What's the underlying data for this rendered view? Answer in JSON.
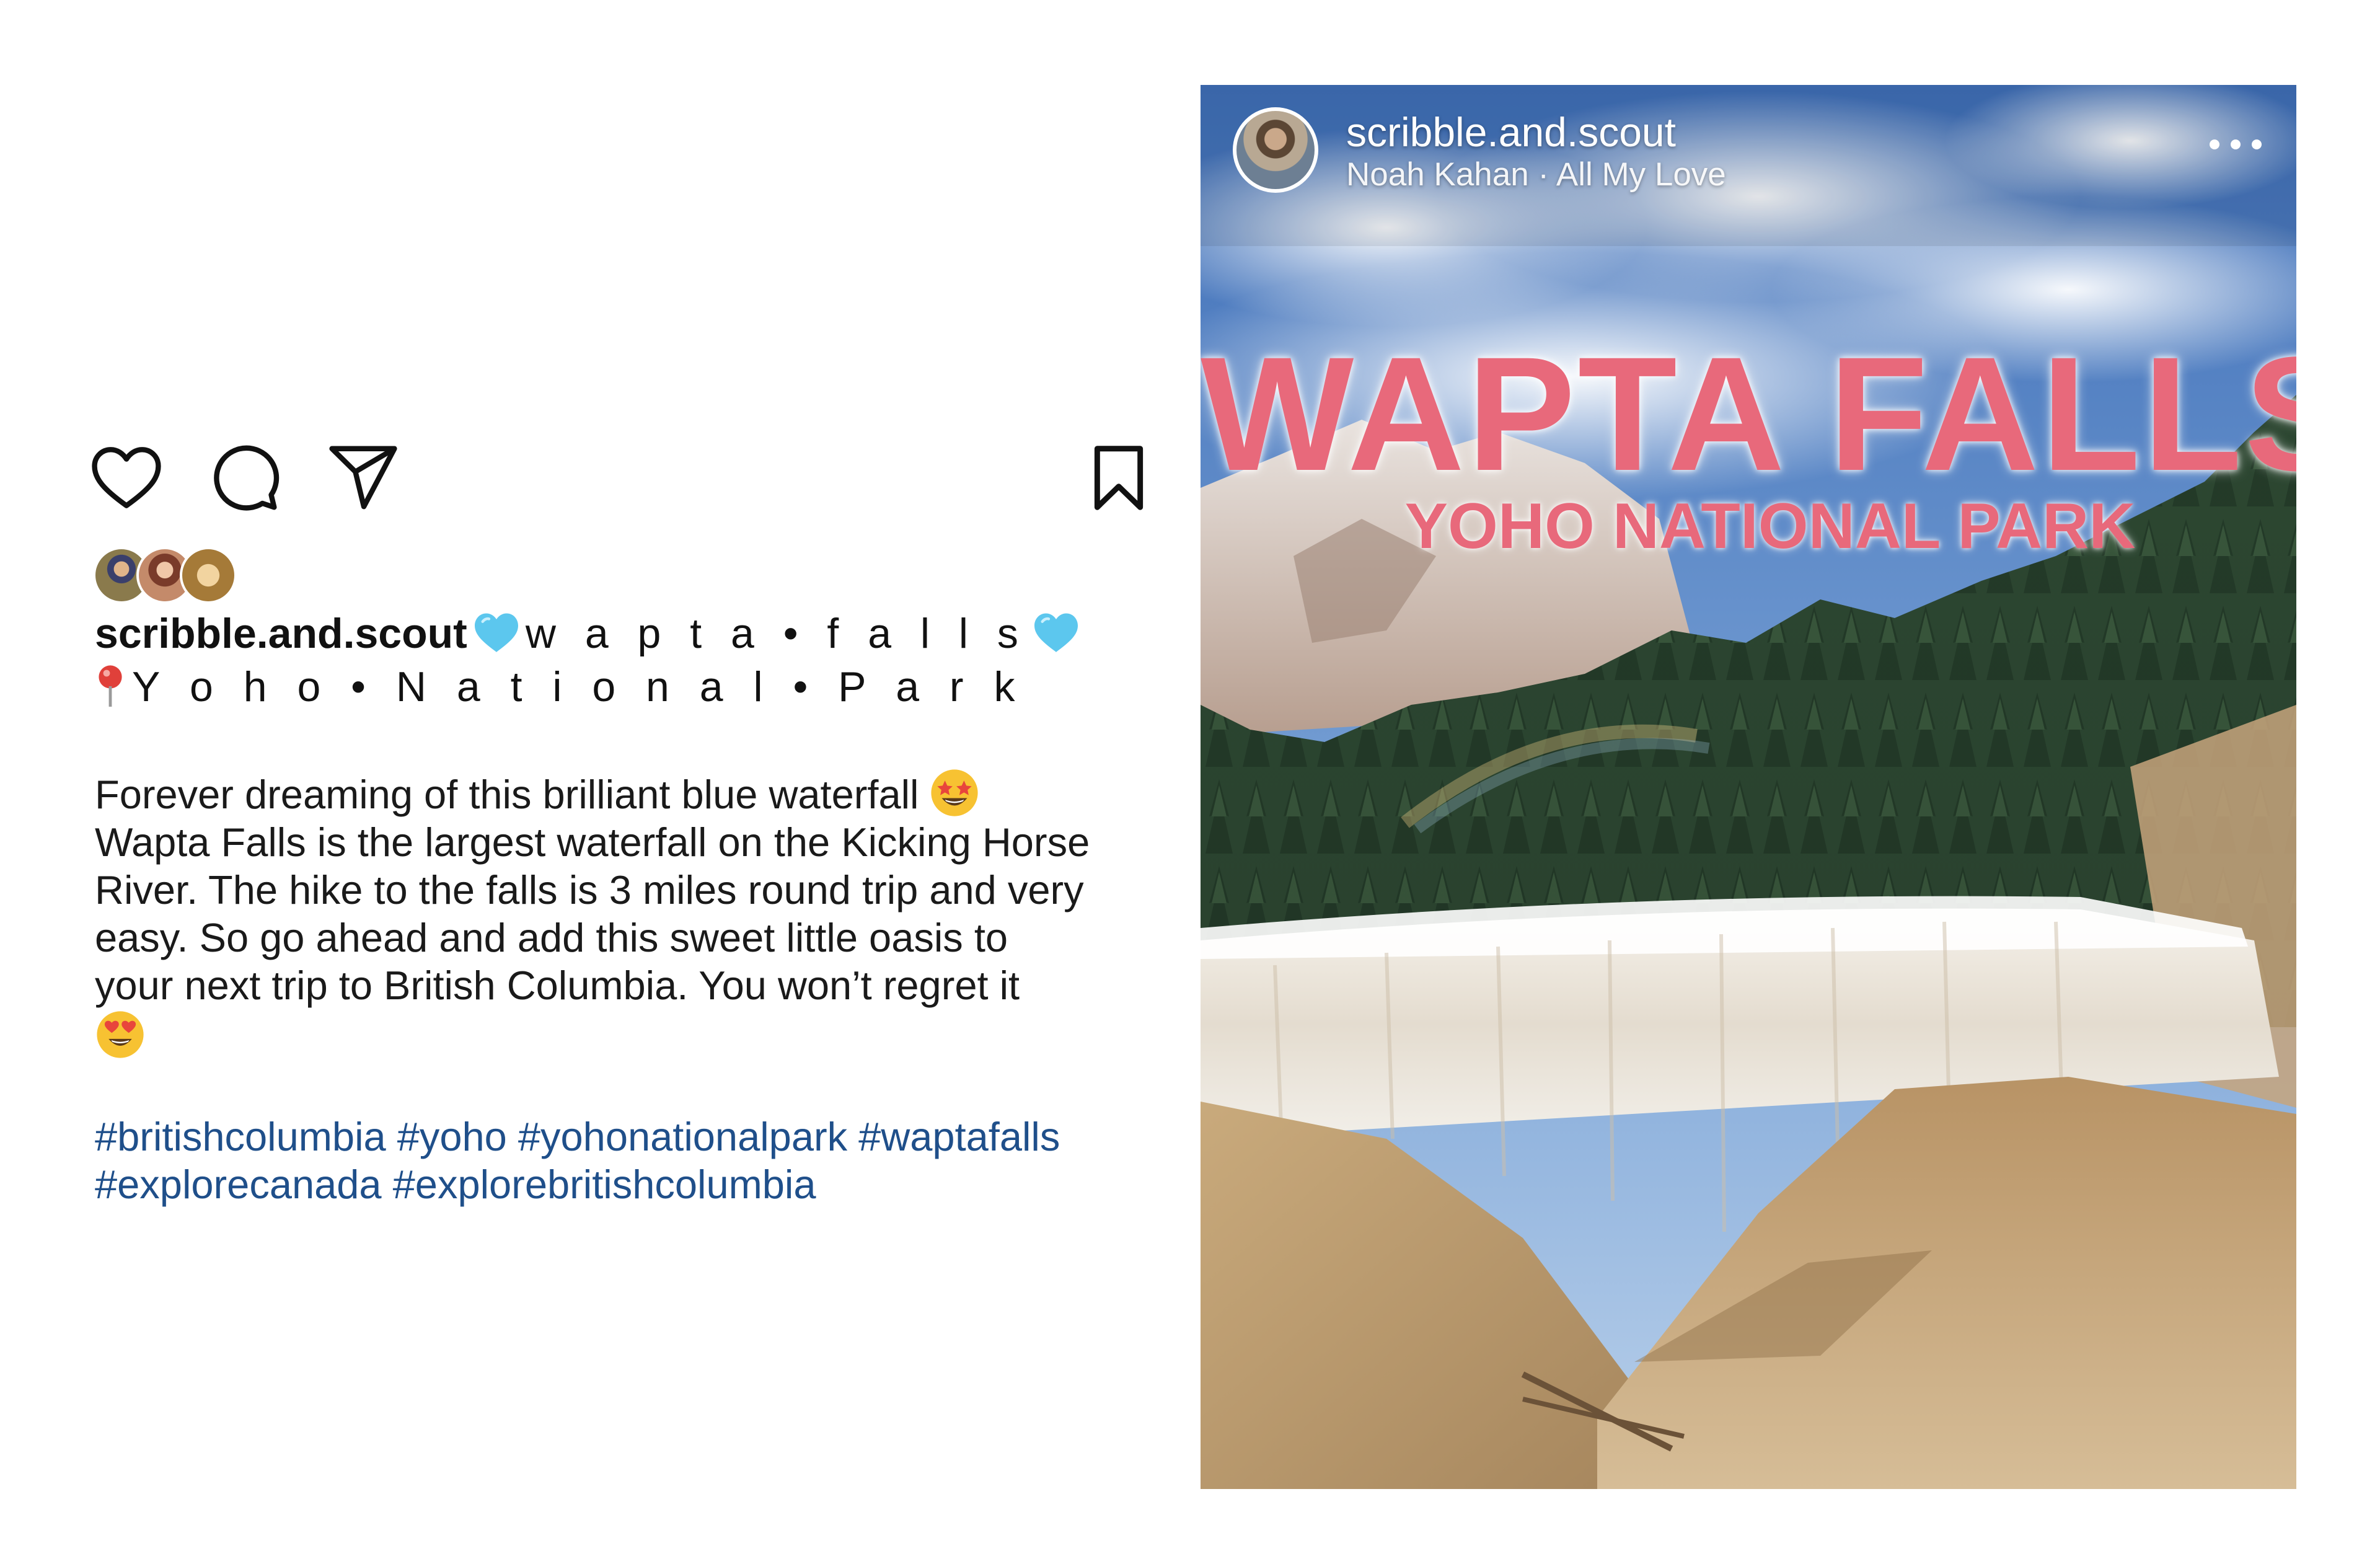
{
  "post": {
    "username": "scribble.and.scout",
    "title_text": "w a p t a • f a l l s",
    "location_text": "Y o h o • N a t i o n a l • P a r k",
    "body_lines": [
      "Forever dreaming of this brilliant blue waterfall",
      "Wapta Falls is the largest waterfall on the Kicking Horse",
      "River. The hike to the falls is 3 miles round trip and very",
      "easy. So go ahead and add this sweet little oasis to",
      "your next trip to British Columbia. You won’t regret it"
    ],
    "hashtag_lines": [
      "#britishcolumbia #yoho #yohonationalpark #waptafalls",
      "#explorecanada #explorebritishcolumbia"
    ],
    "icons": {
      "like": "heart-outline-icon",
      "comment": "comment-bubble-icon",
      "share": "paper-plane-icon",
      "save": "bookmark-icon",
      "title_emoji": "blue-heart-emoji",
      "location_emoji": "round-pushpin-emoji",
      "body_emoji_1": "star-struck-emoji",
      "body_emoji_2": "heart-eyes-emoji"
    },
    "colors": {
      "hashtag": "#1f4f8a",
      "text": "#111111"
    }
  },
  "reel": {
    "username": "scribble.and.scout",
    "audio": "Noah Kahan · All My Love",
    "title_main": "WAPTA FALLS",
    "title_sub": "YOHO NATIONAL PARK",
    "menu_icon": "more-horizontal-icon",
    "colors": {
      "title": "#e8697b"
    }
  }
}
